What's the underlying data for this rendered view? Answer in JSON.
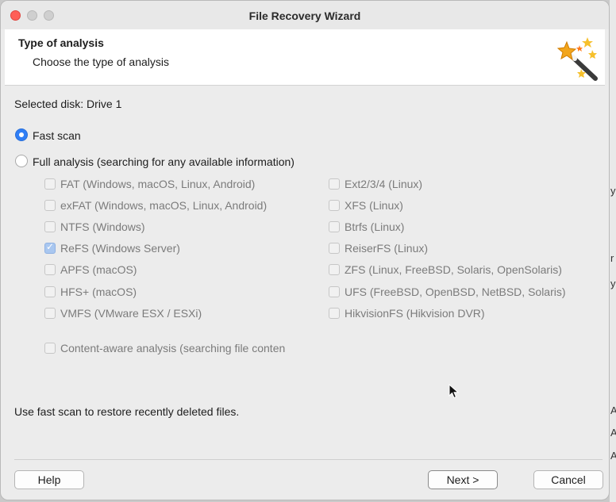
{
  "window": {
    "title": "File Recovery Wizard"
  },
  "header": {
    "title": "Type of analysis",
    "subtitle": "Choose the type of analysis",
    "icon": "magic-wand-icon"
  },
  "selected_disk_text": "Selected disk: Drive 1",
  "options": {
    "fast_scan": {
      "label": "Fast scan",
      "selected": true
    },
    "full_analysis": {
      "label": "Full analysis (searching for any available information)",
      "selected": false
    }
  },
  "filesystems_left": [
    {
      "label": "FAT (Windows, macOS, Linux, Android)",
      "checked": false
    },
    {
      "label": "exFAT (Windows, macOS, Linux, Android)",
      "checked": false
    },
    {
      "label": "NTFS (Windows)",
      "checked": false
    },
    {
      "label": "ReFS (Windows Server)",
      "checked": true
    },
    {
      "label": "APFS (macOS)",
      "checked": false
    },
    {
      "label": "HFS+ (macOS)",
      "checked": false
    },
    {
      "label": "VMFS (VMware ESX / ESXi)",
      "checked": false
    }
  ],
  "filesystems_right": [
    {
      "label": "Ext2/3/4 (Linux)",
      "checked": false
    },
    {
      "label": "XFS (Linux)",
      "checked": false
    },
    {
      "label": "Btrfs (Linux)",
      "checked": false
    },
    {
      "label": "ReiserFS (Linux)",
      "checked": false
    },
    {
      "label": "ZFS (Linux, FreeBSD, Solaris, OpenSolaris)",
      "checked": false
    },
    {
      "label": "UFS (FreeBSD, OpenBSD, NetBSD, Solaris)",
      "checked": false
    },
    {
      "label": "HikvisionFS (Hikvision DVR)",
      "checked": false
    }
  ],
  "content_aware": {
    "label": "Content-aware analysis (searching file conten",
    "checked": false
  },
  "hint_text": "Use fast scan to restore recently deleted files.",
  "buttons": {
    "help": "Help",
    "next": "Next >",
    "cancel": "Cancel"
  },
  "background_fragments": [
    "y",
    "r",
    "y",
    "A",
    "A",
    "A"
  ]
}
